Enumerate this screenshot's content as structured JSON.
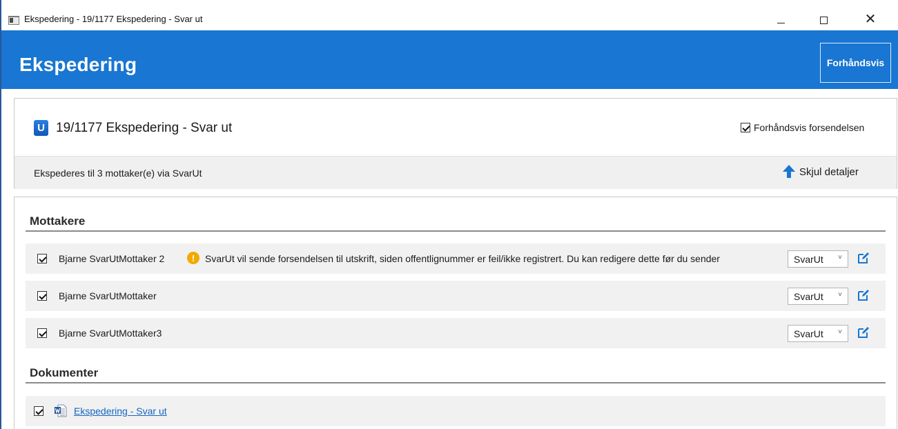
{
  "window": {
    "title": "Ekspedering - 19/1177 Ekspedering - Svar ut",
    "controls": {
      "minimize_icon": "minimize-icon",
      "maximize_icon": "maximize-icon",
      "close_glyph": "✕"
    }
  },
  "header": {
    "title": "Ekspedering",
    "preview_button": "Forhåndsvis",
    "color": "#1976d2"
  },
  "case": {
    "badge": "U",
    "title": "19/1177 Ekspedering - Svar ut",
    "preview_checkbox": {
      "label": "Forhåndsvis forsendelsen",
      "checked": true
    },
    "summary": "Ekspederes til 3 mottaker(e) via SvarUt",
    "toggle_details": "Skjul detaljer"
  },
  "recipients": {
    "heading": "Mottakere",
    "items": [
      {
        "name": "Bjarne SvarUtMottaker 2",
        "checked": true,
        "warning_icon": "!",
        "warning": "SvarUt vil sende forsendelsen til utskrift, siden offentlignummer er feil/ikke registrert. Du kan redigere dette før du sender",
        "channel": "SvarUt"
      },
      {
        "name": "Bjarne SvarUtMottaker",
        "checked": true,
        "channel": "SvarUt"
      },
      {
        "name": "Bjarne SvarUtMottaker3",
        "checked": true,
        "channel": "SvarUt"
      }
    ],
    "channel_chevron": "˅"
  },
  "documents": {
    "heading": "Dokumenter",
    "items": [
      {
        "title": "Ekspedering - Svar ut",
        "checked": true,
        "icon": "word-document-icon"
      }
    ]
  },
  "colors": {
    "accent": "#1976d2",
    "warning": "#f2a900",
    "link": "#1565c0",
    "row_background": "#f1f1f1"
  }
}
